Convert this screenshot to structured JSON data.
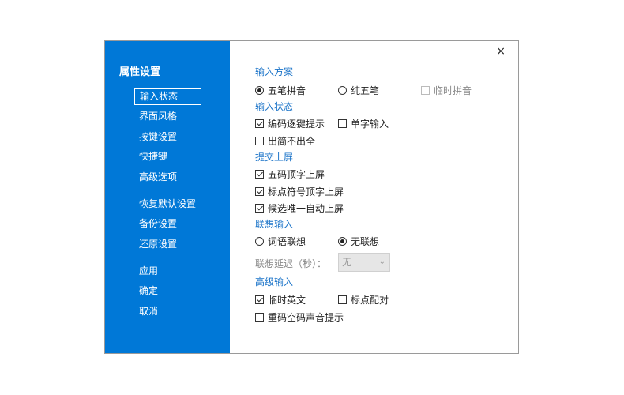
{
  "sidebar": {
    "title": "属性设置",
    "items": [
      {
        "label": "输入状态"
      },
      {
        "label": "界面风格"
      },
      {
        "label": "按键设置"
      },
      {
        "label": "快捷键"
      },
      {
        "label": "高级选项"
      },
      {
        "label": "恢复默认设置"
      },
      {
        "label": "备份设置"
      },
      {
        "label": "还原设置"
      },
      {
        "label": "应用"
      },
      {
        "label": "确定"
      },
      {
        "label": "取消"
      }
    ]
  },
  "close_icon": "×",
  "sections": {
    "input_scheme": "输入方案",
    "input_state": "输入状态",
    "commit": "提交上屏",
    "association": "联想输入",
    "advanced": "高级输入"
  },
  "options": {
    "wubi_pinyin": {
      "label": "五笔拼音",
      "checked": true
    },
    "pure_wubi": {
      "label": "纯五笔",
      "checked": false
    },
    "temp_pinyin": {
      "label": "临时拼音",
      "checked": false,
      "disabled": true
    },
    "code_hint": {
      "label": "编码逐键提示",
      "checked": true
    },
    "single_char": {
      "label": "单字输入",
      "checked": false
    },
    "no_simple": {
      "label": "出简不出全",
      "checked": false
    },
    "five_code": {
      "label": "五码顶字上屏",
      "checked": true
    },
    "punct_top": {
      "label": "标点符号顶字上屏",
      "checked": true
    },
    "unique_auto": {
      "label": "候选唯一自动上屏",
      "checked": true
    },
    "word_assoc": {
      "label": "词语联想",
      "checked": false
    },
    "no_assoc": {
      "label": "无联想",
      "checked": true
    },
    "assoc_delay_label": "联想延迟（秒）：",
    "assoc_delay_value": "无",
    "temp_english": {
      "label": "临时英文",
      "checked": true
    },
    "punct_pair": {
      "label": "标点配对",
      "checked": false
    },
    "dup_sound": {
      "label": "重码空码声音提示",
      "checked": false
    }
  }
}
